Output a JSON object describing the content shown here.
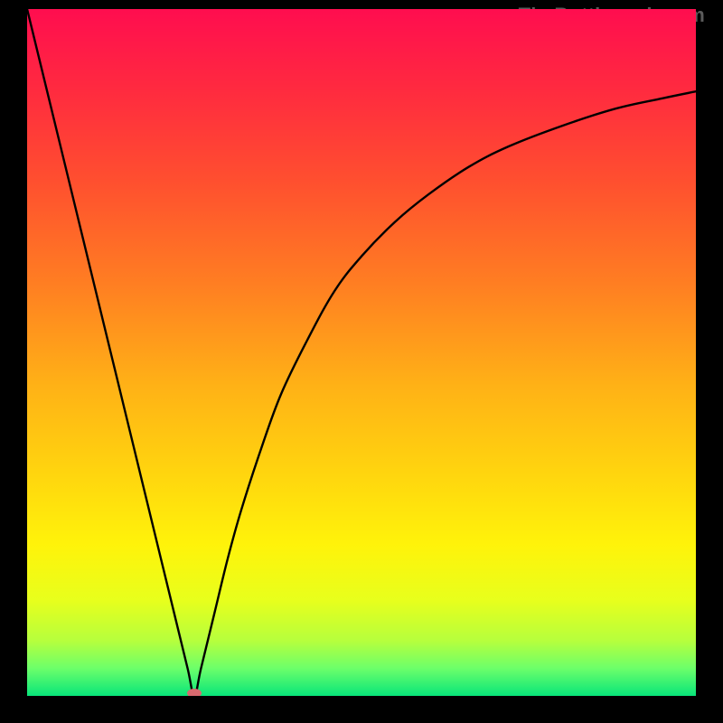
{
  "watermark": "TheBottleneck.com",
  "gradient": {
    "stops": [
      {
        "offset": 0.0,
        "color": "#ff0d4f"
      },
      {
        "offset": 0.12,
        "color": "#ff2b3f"
      },
      {
        "offset": 0.25,
        "color": "#ff4f2f"
      },
      {
        "offset": 0.4,
        "color": "#ff7e22"
      },
      {
        "offset": 0.55,
        "color": "#ffb216"
      },
      {
        "offset": 0.68,
        "color": "#ffd60e"
      },
      {
        "offset": 0.78,
        "color": "#fff30a"
      },
      {
        "offset": 0.86,
        "color": "#e8ff1c"
      },
      {
        "offset": 0.92,
        "color": "#b6ff3d"
      },
      {
        "offset": 0.96,
        "color": "#6cff6a"
      },
      {
        "offset": 1.0,
        "color": "#08e57a"
      }
    ]
  },
  "chart_data": {
    "type": "line",
    "title": "",
    "xlabel": "",
    "ylabel": "",
    "xlim": [
      0,
      100
    ],
    "ylim": [
      0,
      100
    ],
    "minimum_marker": {
      "x": 25,
      "y": 0,
      "color": "#d86a6f"
    },
    "series": [
      {
        "name": "curve",
        "x": [
          0,
          5,
          10,
          15,
          20,
          22,
          24,
          25,
          26,
          28,
          30,
          32,
          35,
          38,
          42,
          46,
          50,
          55,
          60,
          66,
          72,
          80,
          88,
          95,
          100
        ],
        "y": [
          100,
          80,
          60,
          40,
          20,
          12,
          4,
          0,
          4,
          12,
          20,
          27,
          36,
          44,
          52,
          59,
          64,
          69,
          73,
          77,
          80,
          83,
          85.5,
          87,
          88
        ]
      }
    ]
  }
}
